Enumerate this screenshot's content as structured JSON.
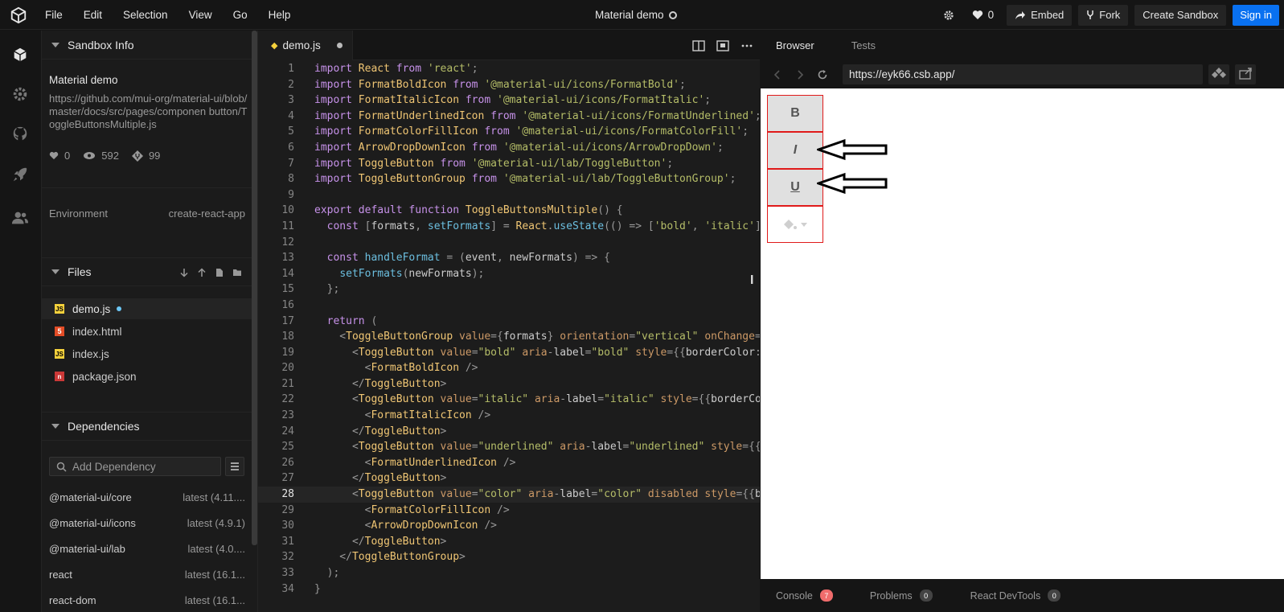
{
  "menu": [
    "File",
    "Edit",
    "Selection",
    "View",
    "Go",
    "Help"
  ],
  "header": {
    "title": "Material demo",
    "likes": "0",
    "embed": "Embed",
    "fork": "Fork",
    "create": "Create Sandbox",
    "signin": "Sign in"
  },
  "sandbox": {
    "heading": "Sandbox Info",
    "title": "Material demo",
    "description": "https://github.com/mui-org/material-ui/blob/master/docs/src/pages/components/toggle-button/ToggleButtonsMultiple.js",
    "description_shown": "https://github.com/mui-org/material-ui/blob/master/docs/src/pages/componen button/ToggleButtonsMultiple.js",
    "likes": "0",
    "views": "592",
    "forks": "99",
    "env_label": "Environment",
    "env_value": "create-react-app"
  },
  "files": {
    "heading": "Files",
    "items": [
      {
        "name": "demo.js",
        "type": "js",
        "modified": true
      },
      {
        "name": "index.html",
        "type": "html",
        "modified": false
      },
      {
        "name": "index.js",
        "type": "js",
        "modified": false
      },
      {
        "name": "package.json",
        "type": "npm",
        "modified": false
      }
    ]
  },
  "dependencies": {
    "heading": "Dependencies",
    "placeholder": "Add Dependency",
    "items": [
      {
        "name": "@material-ui/core",
        "version": "latest (4.11...."
      },
      {
        "name": "@material-ui/icons",
        "version": "latest (4.9.1)"
      },
      {
        "name": "@material-ui/lab",
        "version": "latest (4.0...."
      },
      {
        "name": "react",
        "version": "latest (16.1..."
      },
      {
        "name": "react-dom",
        "version": "latest (16.1..."
      }
    ]
  },
  "editor": {
    "tab": "demo.js",
    "current_line": 28,
    "lines": [
      "import React from 'react';",
      "import FormatBoldIcon from '@material-ui/icons/FormatBold';",
      "import FormatItalicIcon from '@material-ui/icons/FormatItalic';",
      "import FormatUnderlinedIcon from '@material-ui/icons/FormatUnderlined';",
      "import FormatColorFillIcon from '@material-ui/icons/FormatColorFill';",
      "import ArrowDropDownIcon from '@material-ui/icons/ArrowDropDown';",
      "import ToggleButton from '@material-ui/lab/ToggleButton';",
      "import ToggleButtonGroup from '@material-ui/lab/ToggleButtonGroup';",
      "",
      "export default function ToggleButtonsMultiple() {",
      "  const [formats, setFormats] = React.useState(() => ['bold', 'italic']);",
      "",
      "  const handleFormat = (event, newFormats) => {",
      "    setFormats(newFormats);",
      "  };",
      "",
      "  return (",
      "    <ToggleButtonGroup value={formats} orientation=\"vertical\" onChange={handleFormat}>",
      "      <ToggleButton value=\"bold\" aria-label=\"bold\" style={{borderColor: 'red'}}>",
      "        <FormatBoldIcon />",
      "      </ToggleButton>",
      "      <ToggleButton value=\"italic\" aria-label=\"italic\" style={{borderColor: 'red'}}>",
      "        <FormatItalicIcon />",
      "      </ToggleButton>",
      "      <ToggleButton value=\"underlined\" aria-label=\"underlined\" style={{borderColor: 'red'}}>",
      "        <FormatUnderlinedIcon />",
      "      </ToggleButton>",
      "      <ToggleButton value=\"color\" aria-label=\"color\" disabled style={{borderColor: 'red'}}>",
      "        <FormatColorFillIcon />",
      "        <ArrowDropDownIcon />",
      "      </ToggleButton>",
      "    </ToggleButtonGroup>",
      "  );",
      "}"
    ]
  },
  "browser": {
    "tabs": [
      "Browser",
      "Tests"
    ],
    "url": "https://eyk66.csb.app/",
    "toggle_buttons": [
      "B",
      "I",
      "U",
      ""
    ],
    "status": [
      {
        "label": "Console",
        "count": "7",
        "color": "#f06c6c"
      },
      {
        "label": "Problems",
        "count": "0",
        "color": "#444444"
      },
      {
        "label": "React DevTools",
        "count": "0",
        "color": "#444444"
      }
    ]
  },
  "colors": {
    "accent": "#0971f1",
    "toggle_border": "#e01a1a"
  }
}
